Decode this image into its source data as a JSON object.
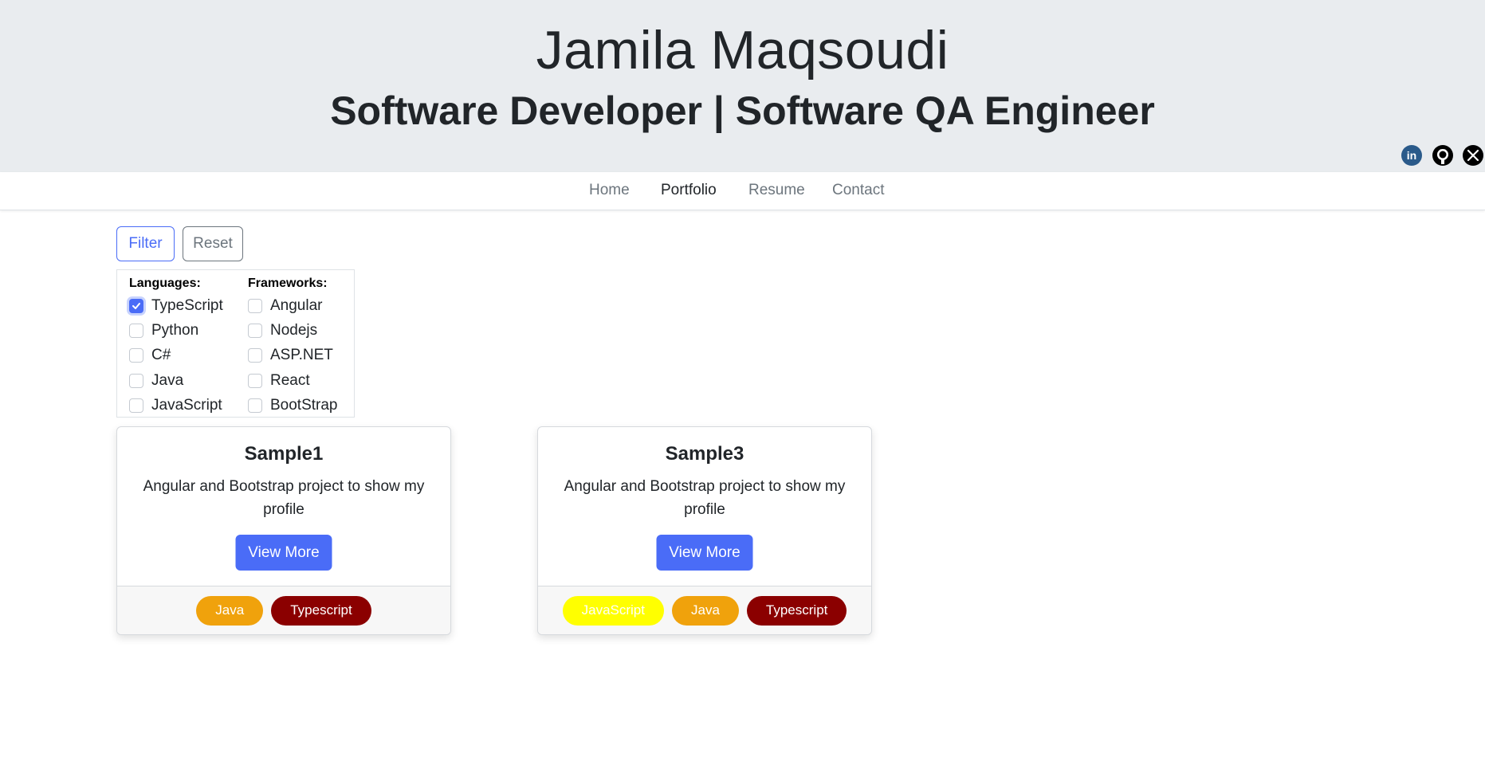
{
  "header": {
    "name": "Jamila Maqsoudi",
    "title": "Software Developer | Software QA Engineer",
    "social": [
      {
        "icon": "linkedin-icon",
        "label": "in",
        "color": "#2a5a8a"
      },
      {
        "icon": "github-icon",
        "color": "#000000"
      },
      {
        "icon": "x-icon",
        "color": "#000000"
      }
    ]
  },
  "nav": {
    "items": [
      {
        "label": "Home",
        "active": false
      },
      {
        "label": "Portfolio",
        "active": true
      },
      {
        "label": "Resume",
        "active": false
      },
      {
        "label": "Contact",
        "active": false
      }
    ]
  },
  "filter": {
    "filter_label": "Filter",
    "reset_label": "Reset",
    "languages_heading": "Languages:",
    "frameworks_heading": "Frameworks:",
    "languages": [
      {
        "label": "TypeScript",
        "checked": true
      },
      {
        "label": "Python",
        "checked": false
      },
      {
        "label": "C#",
        "checked": false
      },
      {
        "label": "Java",
        "checked": false
      },
      {
        "label": "JavaScript",
        "checked": false
      }
    ],
    "frameworks": [
      {
        "label": "Angular",
        "checked": false
      },
      {
        "label": "Nodejs",
        "checked": false
      },
      {
        "label": "ASP.NET",
        "checked": false
      },
      {
        "label": "React",
        "checked": false
      },
      {
        "label": "BootStrap",
        "checked": false
      }
    ]
  },
  "cards": [
    {
      "title": "Sample1",
      "text": "Angular and Bootstrap project to show my profile",
      "button": "View More",
      "tags": [
        {
          "label": "Java",
          "color": "#f0a20c"
        },
        {
          "label": "Typescript",
          "color": "#8b0000"
        }
      ]
    },
    {
      "title": "Sample3",
      "text": "Angular and Bootstrap project to show my profile",
      "button": "View More",
      "tags": [
        {
          "label": "JavaScript",
          "color": "#ffff00"
        },
        {
          "label": "Java",
          "color": "#f0a20c"
        },
        {
          "label": "Typescript",
          "color": "#8b0000"
        }
      ]
    }
  ],
  "colors": {
    "accent": "#4a6cf7",
    "hero_bg": "#e9ecef"
  }
}
